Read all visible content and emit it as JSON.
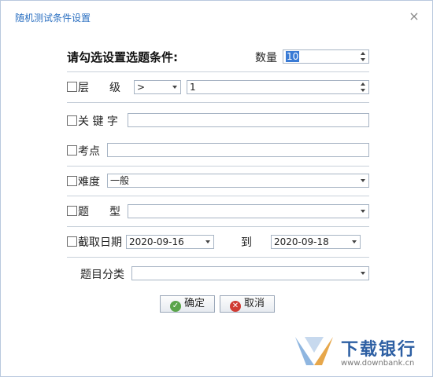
{
  "window": {
    "title": "随机测试条件设置",
    "close_glyph": "×"
  },
  "form": {
    "heading": "请勾选设置选题条件:",
    "quantity": {
      "label": "数量",
      "value": "10"
    },
    "level": {
      "label_a": "层",
      "label_b": "级",
      "operator": ">",
      "value": "1"
    },
    "keyword": {
      "label": "关 键 字",
      "value": ""
    },
    "exam_point": {
      "label": "考点",
      "value": ""
    },
    "difficulty": {
      "label": "难度",
      "value": "一般"
    },
    "question_type": {
      "label_a": "题",
      "label_b": "型",
      "value": ""
    },
    "date_range": {
      "label": "截取日期",
      "from": "2020-09-16",
      "to_label": "到",
      "to": "2020-09-18"
    },
    "category": {
      "label": "题目分类",
      "value": ""
    }
  },
  "buttons": {
    "ok": "确定",
    "cancel": "取消"
  },
  "icons": {
    "ok_icon": "✓",
    "cancel_icon": "✕"
  },
  "watermark": {
    "name": "下载银行",
    "url": "www.downbank.cn"
  },
  "colors": {
    "title": "#2a6fc1",
    "selection": "#3a7bd5",
    "ok": "#5aa54a",
    "cancel": "#d03b33"
  }
}
